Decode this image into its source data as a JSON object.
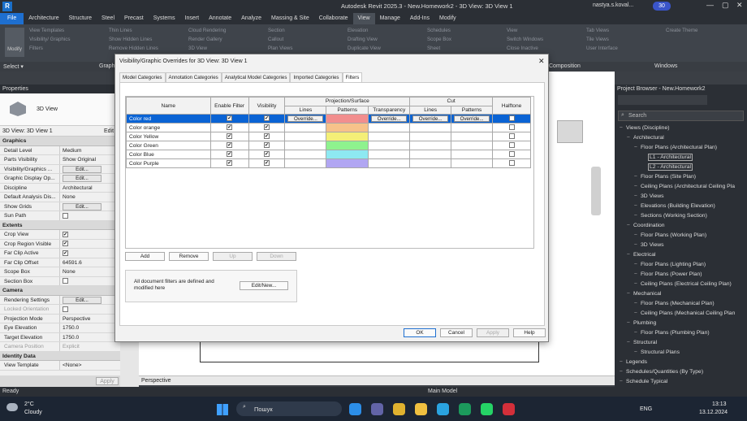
{
  "window": {
    "title": "Autodesk Revit 2025.3 - New.Homework2 - 3D View: 3D View 1",
    "user": "nastya.s.koval...",
    "notif_count": "30"
  },
  "menu": [
    "File",
    "Architecture",
    "Structure",
    "Steel",
    "Precast",
    "Systems",
    "Insert",
    "Annotate",
    "Analyze",
    "Massing & Site",
    "Collaborate",
    "View",
    "Manage",
    "Add-Ins",
    "Modify"
  ],
  "ribbon": {
    "select_label": "Select ▾",
    "groups": [
      "Modify",
      "View Templates",
      "Visibility/ Graphics",
      "Filters",
      "Thin Lines",
      "Show Hidden Lines",
      "Remove Hidden Lines",
      "Cloud Rendering",
      "Render Gallery",
      "3D View",
      "Section",
      "Callout",
      "Plan Views",
      "Elevation",
      "Drafting View",
      "Duplicate View",
      "Schedules",
      "Scope Box",
      "Sheet",
      "View",
      "Switch Windows",
      "Close Inactive",
      "Tab Views",
      "Tile Views",
      "User Interface",
      "Create Theme"
    ],
    "footer": [
      "Graphics",
      "Composition",
      "Windows"
    ]
  },
  "properties": {
    "title": "Properties",
    "type_name": "3D View",
    "instance": "3D View: 3D View 1",
    "edit_type": "Edit",
    "sections": [
      {
        "name": "Graphics",
        "rows": [
          [
            "Detail Level",
            "Medium"
          ],
          [
            "Parts Visibility",
            "Show Original"
          ],
          [
            "Visibility/Graphics ...",
            "Edit..."
          ],
          [
            "Graphic Display Op...",
            "Edit..."
          ],
          [
            "Discipline",
            "Architectural"
          ],
          [
            "Default Analysis Dis...",
            "None"
          ],
          [
            "Show Grids",
            "Edit..."
          ],
          [
            "Sun Path",
            ""
          ]
        ]
      },
      {
        "name": "Extents",
        "rows": [
          [
            "Crop View",
            ""
          ],
          [
            "Crop Region Visible",
            ""
          ],
          [
            "Far Clip Active",
            ""
          ],
          [
            "Far Clip Offset",
            "64591.6"
          ],
          [
            "Scope Box",
            "None"
          ],
          [
            "Section Box",
            ""
          ]
        ]
      },
      {
        "name": "Camera",
        "rows": [
          [
            "Rendering Settings",
            "Edit..."
          ],
          [
            "Locked Orientation",
            ""
          ],
          [
            "Projection Mode",
            "Perspective"
          ],
          [
            "Eye Elevation",
            "1750.0"
          ],
          [
            "Target Elevation",
            "1750.0"
          ],
          [
            "Camera Position",
            "Explicit"
          ]
        ]
      },
      {
        "name": "Identity Data",
        "rows": [
          [
            "View Template",
            "<None>"
          ]
        ]
      }
    ],
    "help_link": "Properties help",
    "apply": "Apply"
  },
  "browser": {
    "title": "Project Browser - New.Homework2",
    "search_placeholder": "Search",
    "items": [
      "Views (Discipline)",
      "Architectural",
      "Floor Plans (Architectural Plan)",
      "L1 - Architectural",
      "L2 - Architectural",
      "Floor Plans (Site Plan)",
      "Ceiling Plans (Architectural Ceiling Pla",
      "3D Views",
      "Elevations (Building Elevation)",
      "Sections (Working Section)",
      "Coordination",
      "Floor Plans (Working Plan)",
      "3D Views",
      "Electrical",
      "Floor Plans (Lighting Plan)",
      "Floor Plans (Power Plan)",
      "Ceiling Plans (Electrical Ceiling Plan)",
      "Mechanical",
      "Floor Plans (Mechanical Plan)",
      "Ceiling Plans (Mechanical Ceiling Plan",
      "Plumbing",
      "Floor Plans (Plumbing Plan)",
      "Structural",
      "Structural Plans",
      "Legends",
      "Schedules/Quantities (By Type)",
      "Schedule Typical"
    ]
  },
  "dialog": {
    "title": "Visibility/Graphic Overrides for 3D View: 3D View 1",
    "tabs": [
      "Model Categories",
      "Annotation Categories",
      "Analytical Model Categories",
      "Imported Categories",
      "Filters"
    ],
    "headers": {
      "name": "Name",
      "enable": "Enable Filter",
      "visibility": "Visibility",
      "proj": "Projection/Surface",
      "cut": "Cut",
      "halftone": "Halftone",
      "lines": "Lines",
      "patterns": "Patterns",
      "transparency": "Transparency"
    },
    "override_label": "Override...",
    "filters": [
      {
        "name": "Color red",
        "color": "#f28e8e"
      },
      {
        "name": "Color orange",
        "color": "#f7c28a"
      },
      {
        "name": "Color Yellow",
        "color": "#f4ef77"
      },
      {
        "name": "Color Green",
        "color": "#8ef28e"
      },
      {
        "name": "Color Blue",
        "color": "#8ee9f2"
      },
      {
        "name": "Color Purple",
        "color": "#b1a6f2"
      }
    ],
    "buttons": {
      "add": "Add",
      "remove": "Remove",
      "up": "Up",
      "down": "Down",
      "edit_new": "Edit/New...",
      "ok": "OK",
      "cancel": "Cancel",
      "apply": "Apply",
      "help": "Help"
    },
    "note": "All document filters are defined and modified here"
  },
  "viewbar": {
    "mode": "Perspective"
  },
  "status": {
    "ready": "Ready",
    "model": "Main Model"
  },
  "taskbar": {
    "temp": "2°C",
    "weather": "Cloudy",
    "search": "Пошук",
    "lang": "ENG",
    "time": "13:13",
    "date": "13.12.2024"
  }
}
